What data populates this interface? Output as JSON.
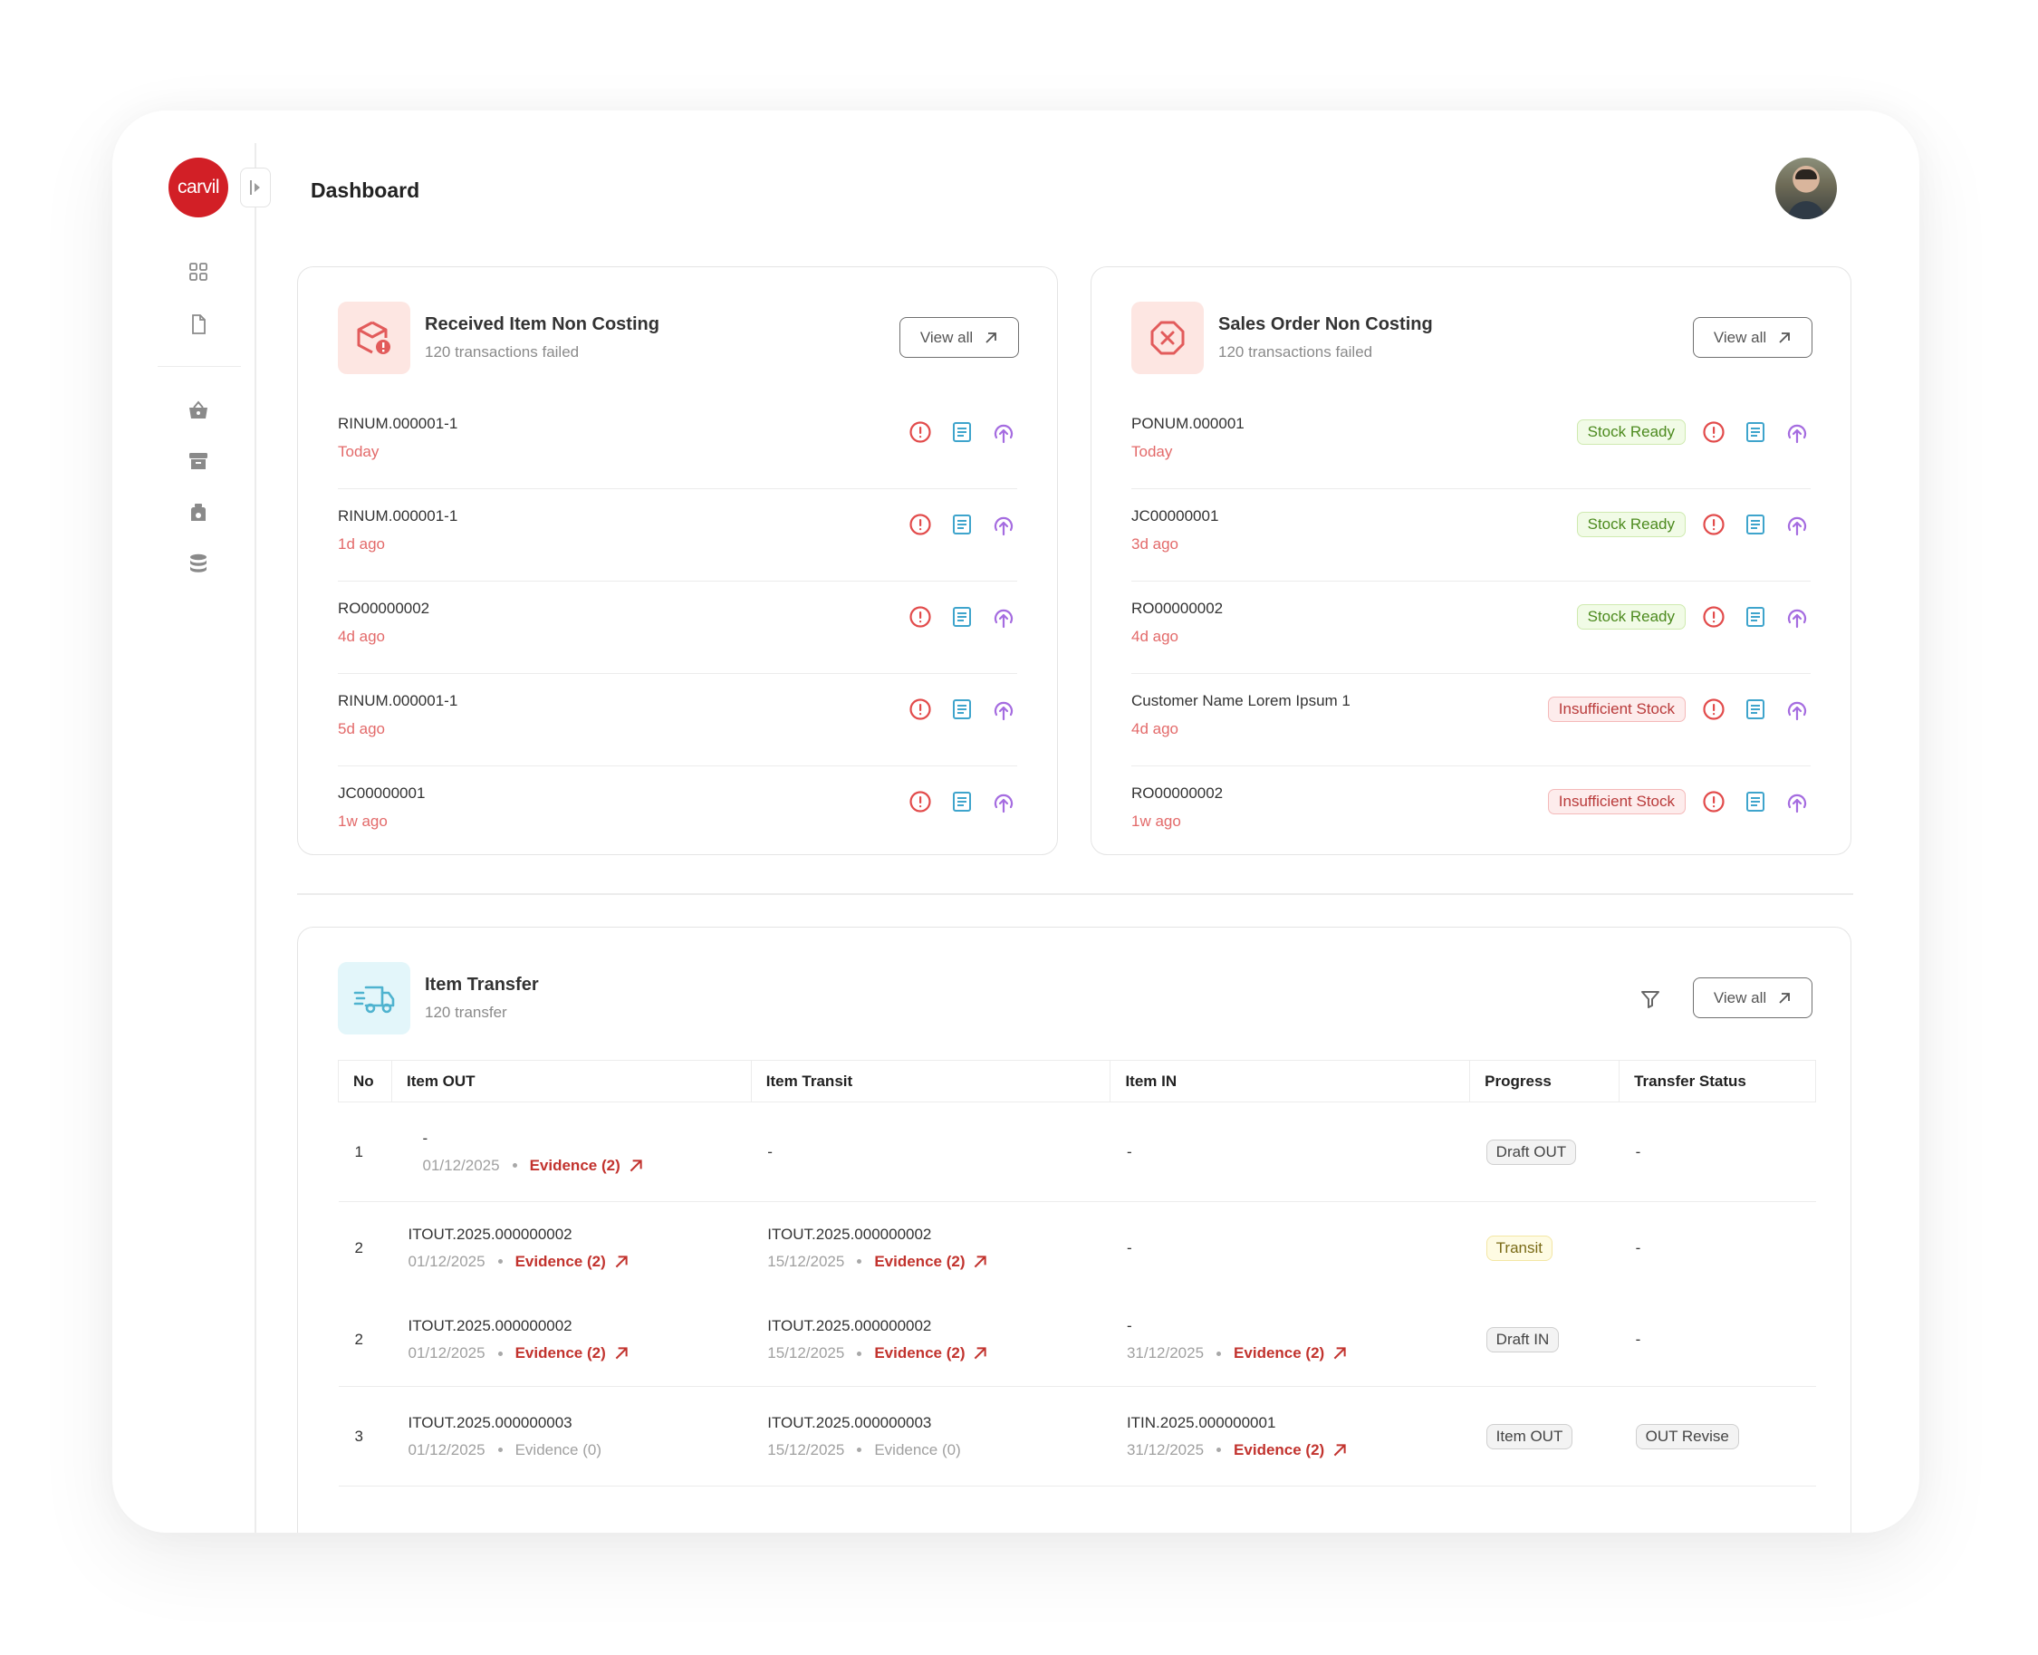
{
  "brand": {
    "logo_text": "carvil",
    "accent": "#d21f26"
  },
  "header": {
    "title": "Dashboard"
  },
  "sidebar": {
    "items": [
      {
        "icon": "grid-icon"
      },
      {
        "icon": "document-icon"
      },
      {
        "icon": "basket-icon"
      },
      {
        "icon": "archive-icon"
      },
      {
        "icon": "weight-icon"
      },
      {
        "icon": "database-icon"
      }
    ]
  },
  "received_card": {
    "title": "Received Item Non Costing",
    "subtitle": "120 transactions failed",
    "view_all": "View all",
    "rows": [
      {
        "id": "RINUM.000001-1",
        "time": "Today"
      },
      {
        "id": "RINUM.000001-1",
        "time": "1d ago"
      },
      {
        "id": "RO00000002",
        "time": "4d ago"
      },
      {
        "id": "RINUM.000001-1",
        "time": "5d ago"
      },
      {
        "id": "JC00000001",
        "time": "1w ago"
      }
    ]
  },
  "sales_card": {
    "title": "Sales Order Non Costing",
    "subtitle": "120 transactions failed",
    "view_all": "View all",
    "rows": [
      {
        "id": "PONUM.000001",
        "time": "Today",
        "status": "Stock Ready"
      },
      {
        "id": "JC00000001",
        "time": "3d ago",
        "status": "Stock Ready"
      },
      {
        "id": "RO00000002",
        "time": "4d ago",
        "status": "Stock Ready"
      },
      {
        "id": "Customer Name Lorem Ipsum 1",
        "time": "4d ago",
        "status": "Insufficient Stock"
      },
      {
        "id": "RO00000002",
        "time": "1w ago",
        "status": "Insufficient Stock"
      }
    ]
  },
  "transfer_card": {
    "title": "Item Transfer",
    "subtitle": "120 transfer",
    "view_all": "View all",
    "columns": [
      "No",
      "Item OUT",
      "Item Transit",
      "Item IN",
      "Progress",
      "Transfer Status"
    ],
    "rows": [
      {
        "no": "1",
        "out": {
          "code": "-",
          "date": "01/12/2025",
          "evidence": "Evidence (2)"
        },
        "transit": "-",
        "in": "-",
        "progress": "Draft OUT",
        "status": "-"
      },
      {
        "no": "2",
        "out": {
          "code": "ITOUT.2025.000000002",
          "date": "01/12/2025",
          "evidence": "Evidence (2)"
        },
        "transit": {
          "code": "ITOUT.2025.000000002",
          "date": "15/12/2025",
          "evidence": "Evidence (2)"
        },
        "in": "-",
        "progress": "Transit",
        "status": "-"
      },
      {
        "no": "2",
        "out": {
          "code": "ITOUT.2025.000000002",
          "date": "01/12/2025",
          "evidence": "Evidence (2)"
        },
        "transit": {
          "code": "ITOUT.2025.000000002",
          "date": "15/12/2025",
          "evidence": "Evidence (2)"
        },
        "in": {
          "code": "-",
          "date": "31/12/2025",
          "evidence": "Evidence (2)"
        },
        "progress": "Draft IN",
        "status": "-"
      },
      {
        "no": "3",
        "out": {
          "code": "ITOUT.2025.000000003",
          "date": "01/12/2025",
          "evidence": "Evidence (0)"
        },
        "transit": {
          "code": "ITOUT.2025.000000003",
          "date": "15/12/2025",
          "evidence": "Evidence (0)"
        },
        "in": {
          "code": "ITIN.2025.000000001",
          "date": "31/12/2025",
          "evidence": "Evidence (2)"
        },
        "progress": "Item OUT",
        "status": "OUT Revise"
      }
    ]
  }
}
